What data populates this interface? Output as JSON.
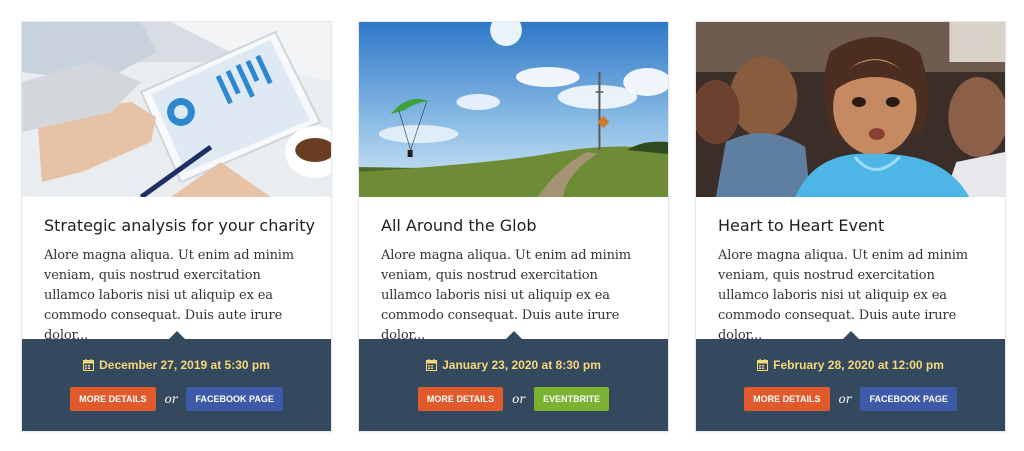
{
  "events": [
    {
      "title": "Strategic analysis for your charity",
      "excerpt": "Alore magna aliqua. Ut enim ad minim veniam, quis nostrud exercitation ullamco laboris nisi ut aliquip ex ea commodo consequat. Duis aute irure dolor...",
      "date": "December 27, 2019 at 5:30 pm",
      "details_label": "MORE DETAILS",
      "or_label": "or",
      "secondary_label": "FACEBOOK PAGE",
      "secondary_color": "#3d5aa8"
    },
    {
      "title": "All Around the Glob",
      "excerpt": "Alore magna aliqua. Ut enim ad minim veniam, quis nostrud exercitation ullamco laboris nisi ut aliquip ex ea commodo consequat. Duis aute irure dolor...",
      "date": "January 23, 2020 at 8:30 pm",
      "details_label": "MORE DETAILS",
      "or_label": "or",
      "secondary_label": "EVENTBRITE",
      "secondary_color": "#7cb232"
    },
    {
      "title": "Heart to Heart Event",
      "excerpt": "Alore magna aliqua. Ut enim ad minim veniam, quis nostrud exercitation ullamco laboris nisi ut aliquip ex ea commodo consequat. Duis aute irure dolor...",
      "date": "February 28, 2020 at 12:00 pm",
      "details_label": "MORE DETAILS",
      "or_label": "or",
      "secondary_label": "FACEBOOK PAGE",
      "secondary_color": "#3d5aa8"
    }
  ],
  "colors": {
    "footer_bg": "#34495e",
    "date_text": "#f6d77a",
    "details_button": "#e05a2b"
  },
  "icons": {
    "date": "calendar-icon"
  }
}
